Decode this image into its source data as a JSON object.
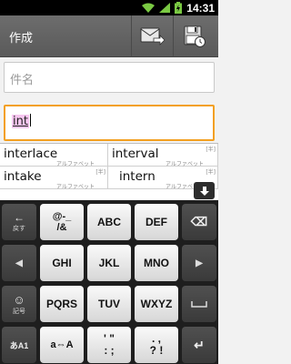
{
  "status_bar": {
    "time": "14:31",
    "icons": [
      "wifi-icon",
      "signal-icon",
      "battery-charging-icon"
    ]
  },
  "action_bar": {
    "title": "作成",
    "actions": [
      "send-icon",
      "save-icon"
    ]
  },
  "subject": {
    "placeholder": "件名"
  },
  "body": {
    "composing_text": "int"
  },
  "candidates": [
    {
      "word": "interlace",
      "tag_top": "",
      "tag": "アルファベット"
    },
    {
      "word": "interval",
      "tag_top": "[半]",
      "tag": "アルファベット"
    },
    {
      "word": "intake",
      "tag_top": "[半]",
      "tag": "アルファベット"
    },
    {
      "word": "intern",
      "tag_top": "[半]",
      "tag": "アルファベット"
    }
  ],
  "keyboard": {
    "rows": [
      [
        {
          "label": "←",
          "sub": "戻す",
          "style": "dark"
        },
        {
          "label": "@-_\n/&",
          "style": "light"
        },
        {
          "label": "ABC",
          "style": "light"
        },
        {
          "label": "DEF",
          "style": "light"
        },
        {
          "label": "⌫",
          "style": "dark"
        }
      ],
      [
        {
          "label": "◀",
          "style": "dark"
        },
        {
          "label": "GHI",
          "style": "light"
        },
        {
          "label": "JKL",
          "style": "light"
        },
        {
          "label": "MNO",
          "style": "light"
        },
        {
          "label": "▶",
          "style": "dark"
        }
      ],
      [
        {
          "label": "☺",
          "sub": "記号",
          "style": "dark"
        },
        {
          "label": "PQRS",
          "style": "light"
        },
        {
          "label": "TUV",
          "style": "light"
        },
        {
          "label": "WXYZ",
          "style": "light"
        },
        {
          "label": "",
          "style": "dark"
        }
      ],
      [
        {
          "label": "あA1",
          "style": "dark"
        },
        {
          "label": "a⇔A",
          "style": "light"
        },
        {
          "label": "' \"\n: ;",
          "style": "light"
        },
        {
          "label": ". ,\n? !",
          "style": "light"
        },
        {
          "label": "↵",
          "style": "dark"
        }
      ]
    ]
  },
  "colors": {
    "action_bar": "#606060",
    "focus_border": "#f3a020",
    "composing_highlight": "#f7c6f0",
    "keyboard_bg": "#1e1e1e"
  }
}
